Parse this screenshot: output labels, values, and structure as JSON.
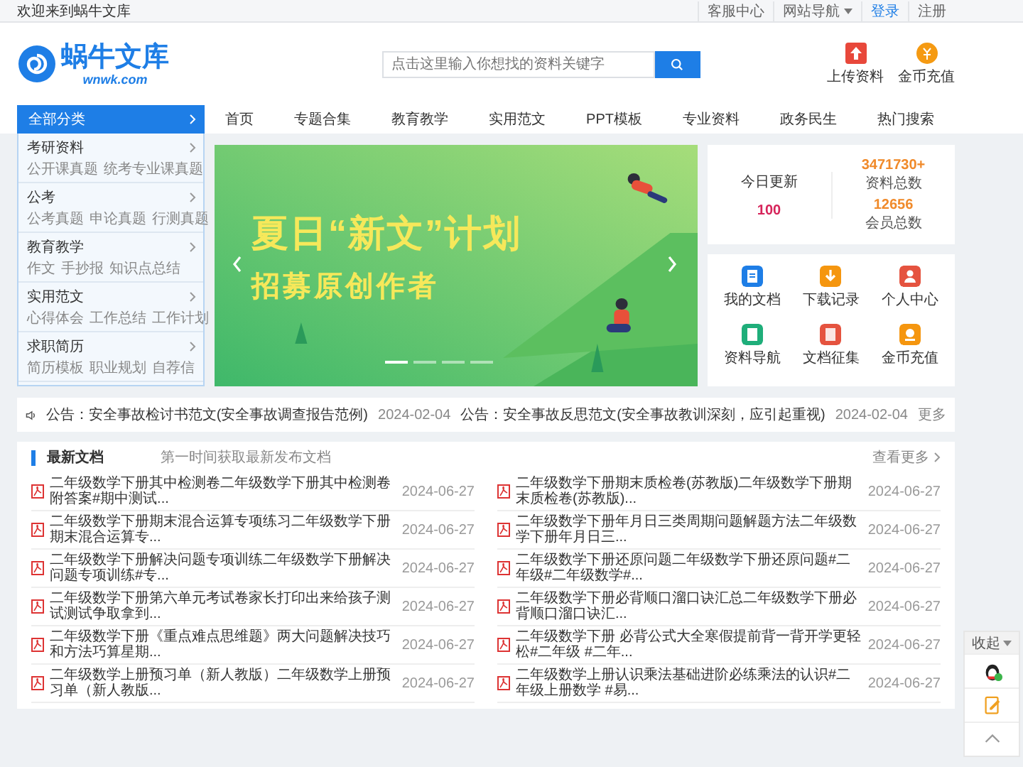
{
  "top_bar": {
    "welcome": "欢迎来到蜗牛文库",
    "links": [
      {
        "label": "客服中心",
        "kind": "plain"
      },
      {
        "label": "网站导航",
        "kind": "dropdown"
      },
      {
        "label": "登录",
        "kind": "primary"
      },
      {
        "label": "注册",
        "kind": "plain"
      }
    ]
  },
  "header": {
    "logo_text": "蜗牛文库",
    "logo_domain": "wnwk.com",
    "search": {
      "placeholder": "点击这里输入你想找的资料关键字"
    },
    "actions": [
      {
        "label": "上传资料",
        "color": "#e8483b"
      },
      {
        "label": "金币充值",
        "color": "#f59a12"
      }
    ]
  },
  "nav": {
    "all_label": "全部分类",
    "items": [
      "首页",
      "专题合集",
      "教育教学",
      "实用范文",
      "PPT模板",
      "专业资料",
      "政务民生",
      "热门搜索"
    ]
  },
  "sidebar": {
    "groups": [
      {
        "title": "考研资料",
        "links": [
          "公开课真题",
          "统考专业课真题"
        ]
      },
      {
        "title": "公考",
        "links": [
          "公考真题",
          "申论真题",
          "行测真题"
        ]
      },
      {
        "title": "教育教学",
        "links": [
          "作文",
          "手抄报",
          "知识点总结"
        ]
      },
      {
        "title": "实用范文",
        "links": [
          "心得体会",
          "工作总结",
          "工作计划"
        ]
      },
      {
        "title": "求职简历",
        "links": [
          "简历模板",
          "职业规划",
          "自荐信"
        ]
      }
    ]
  },
  "banner": {
    "title": "夏日“新文”计划",
    "subtitle": "招募原创作者",
    "dots": [
      {
        "selected": true
      },
      {
        "selected": false
      },
      {
        "selected": false
      },
      {
        "selected": false
      }
    ]
  },
  "stats": {
    "today_label": "今日更新",
    "today_value": "100",
    "items": [
      {
        "value": "3471730+",
        "label": "资料总数"
      },
      {
        "value": "12656",
        "label": "会员总数"
      }
    ]
  },
  "quick_links": [
    {
      "label": "我的文档",
      "color": "#1e7ee6"
    },
    {
      "label": "下载记录",
      "color": "#f5960f"
    },
    {
      "label": "个人中心",
      "color": "#e5533f"
    },
    {
      "label": "资料导航",
      "color": "#1fae7a"
    },
    {
      "label": "文档征集",
      "color": "#e5533f"
    },
    {
      "label": "金币充值",
      "color": "#f5960f"
    }
  ],
  "notices": [
    {
      "text": "公告：安全事故检讨书范文(安全事故调查报告范例)",
      "date": "2024-02-04"
    },
    {
      "text": "公告：安全事故反思范文(安全事故教训深刻，应引起重视)",
      "date": "2024-02-04"
    }
  ],
  "notice_more": "更多",
  "latest": {
    "title": "最新文档",
    "subtitle": "第一时间获取最新发布文档",
    "more": "查看更多",
    "docs": [
      {
        "title": "二年级数学下册其中检测卷二年级数学下册其中检测卷附答案#期中测试...",
        "date": "2024-06-27"
      },
      {
        "title": "二年级数学下册期末质检卷(苏教版)二年级数学下册期末质检卷(苏教版)...",
        "date": "2024-06-27"
      },
      {
        "title": "二年级数学下册期末混合运算专项练习二年级数学下册期末混合运算专...",
        "date": "2024-06-27"
      },
      {
        "title": "二年级数学下册年月日三类周期问题解题方法二年级数学下册年月日三...",
        "date": "2024-06-27"
      },
      {
        "title": "二年级数学下册解决问题专项训练二年级数学下册解决问题专项训练#专...",
        "date": "2024-06-27"
      },
      {
        "title": "二年级数学下册还原问题二年级数学下册还原问题#二年级#二年级数学#...",
        "date": "2024-06-27"
      },
      {
        "title": "二年级数学下册第六单元考试卷家长打印出来给孩子测试测试争取拿到...",
        "date": "2024-06-27"
      },
      {
        "title": "二年级数学下册必背顺口溜口诀汇总二年级数学下册必背顺口溜口诀汇...",
        "date": "2024-06-27"
      },
      {
        "title": "二年级数学下册《重点难点思维题》两大问题解决技巧和方法巧算星期...",
        "date": "2024-06-27"
      },
      {
        "title": "二年级数学下册 必背公式大全寒假提前背一背开学更轻松#二年级 #二年...",
        "date": "2024-06-27"
      },
      {
        "title": "二年级数学上册预习单（新人教版）二年级数学上册预习单（新人教版...",
        "date": "2024-06-27"
      },
      {
        "title": "二年级数学上册认识乘法基础进阶必练乘法的认识#二年级上册数学 #易...",
        "date": "2024-06-27"
      }
    ]
  },
  "side_panel": {
    "collapse_label": "收起"
  }
}
